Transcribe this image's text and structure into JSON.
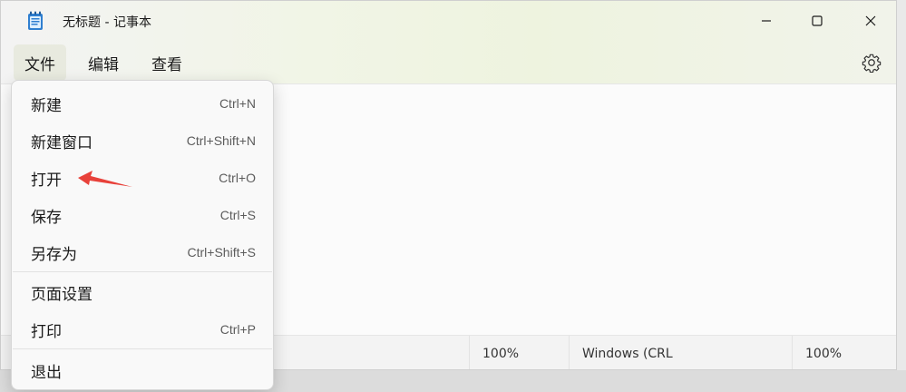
{
  "window": {
    "title": "无标题 - 记事本"
  },
  "menubar": {
    "items": [
      "文件",
      "编辑",
      "查看"
    ]
  },
  "file_menu": {
    "items": [
      {
        "label": "新建",
        "shortcut": "Ctrl+N"
      },
      {
        "label": "新建窗口",
        "shortcut": "Ctrl+Shift+N"
      },
      {
        "label": "打开",
        "shortcut": "Ctrl+O"
      },
      {
        "label": "保存",
        "shortcut": "Ctrl+S"
      },
      {
        "label": "另存为",
        "shortcut": "Ctrl+Shift+S"
      },
      {
        "label": "页面设置",
        "shortcut": ""
      },
      {
        "label": "打印",
        "shortcut": "Ctrl+P"
      },
      {
        "label": "退出",
        "shortcut": ""
      }
    ]
  },
  "statusbar": {
    "zoom": "100%",
    "line_ending": "Windows (CRL",
    "zoom2": "100%"
  },
  "colors": {
    "annotation_arrow": "#e8413a"
  },
  "icons": {
    "app": "notepad-icon",
    "minimize": "minimize-icon",
    "maximize": "maximize-icon",
    "close": "close-icon",
    "settings": "gear-icon",
    "annotation": "red-arrow-icon"
  }
}
